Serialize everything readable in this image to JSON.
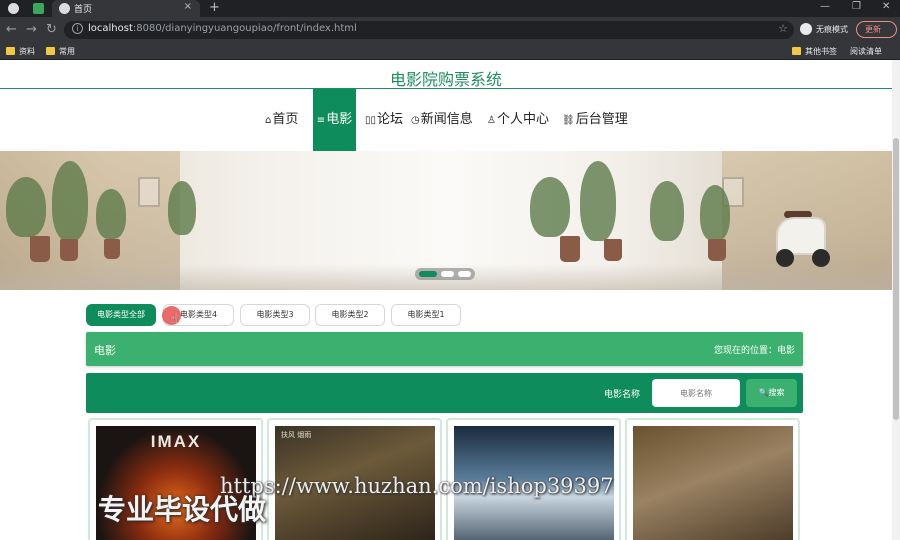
{
  "browser": {
    "active_tab_title": "首页",
    "tab_close": "×",
    "new_tab": "+",
    "url_host": "localhost",
    "url_rest": ":8080/dianyingyuangoupiao/front/index.html",
    "incognito_label": "无痕模式",
    "update_label": "更新",
    "window_min": "—",
    "window_max": "❐",
    "window_close": "✕",
    "nav_back": "←",
    "nav_forward": "→",
    "nav_reload": "↻",
    "star": "☆",
    "bookmarks": [
      "资料",
      "常用"
    ],
    "bookmarks_right": [
      "其他书签",
      "阅读清单"
    ]
  },
  "site": {
    "title": "电影院购票系统"
  },
  "nav": {
    "items": [
      {
        "icon": "⌂",
        "label": "首页"
      },
      {
        "icon": "≡",
        "label": "电影"
      },
      {
        "icon": "▯▯",
        "label": "论坛"
      },
      {
        "icon": "◷",
        "label": "新闻信息"
      },
      {
        "icon": "♙",
        "label": "个人中心"
      },
      {
        "icon": "⛓",
        "label": "后台管理"
      }
    ],
    "active_index": 1
  },
  "banner": {
    "slide_count": 3,
    "active_slide": 0
  },
  "categories": {
    "items": [
      "电影类型全部",
      "电影类型4",
      "电影类型3",
      "电影类型2",
      "电影类型1"
    ],
    "active_index": 0
  },
  "section": {
    "title": "电影",
    "location_label": "您现在的位置：电影"
  },
  "search": {
    "label": "电影名称",
    "placeholder": "电影名称",
    "button_icon": "🔍",
    "button_label": "搜索"
  },
  "movies": [
    {
      "poster_text": "IMAX"
    },
    {
      "poster_text": "扶风 烟雨"
    },
    {
      "poster_text": ""
    },
    {
      "poster_text": ""
    }
  ],
  "watermark": {
    "url": "https://www.huzhan.com/ishop39397",
    "text": "专业毕设代做"
  },
  "colors": {
    "primary": "#0f8c5c",
    "accent": "#3bb06f",
    "title": "#1e8e5f"
  }
}
